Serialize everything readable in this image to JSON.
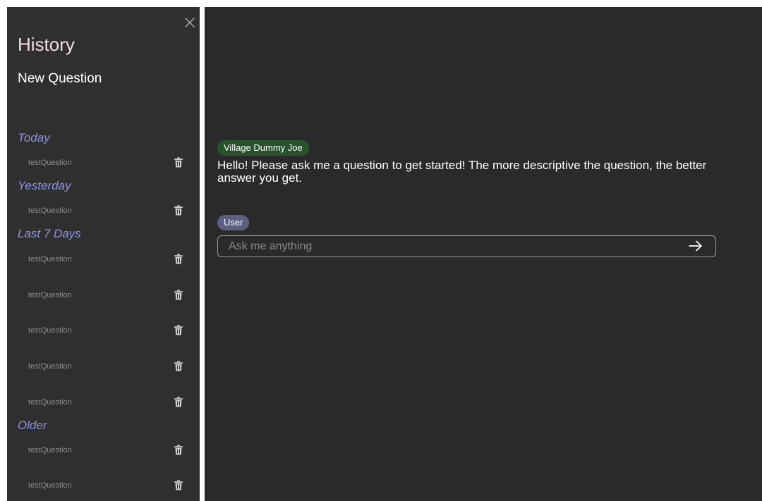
{
  "sidebar": {
    "title": "History",
    "new_question": "New Question",
    "sections": {
      "today": {
        "heading": "Today",
        "items": [
          "testQuestion"
        ]
      },
      "yesterday": {
        "heading": "Yesterday",
        "items": [
          "testQuestion"
        ]
      },
      "last7": {
        "heading": "Last 7 Days",
        "items": [
          "testQuestion",
          "testQuestion",
          "testQuestion",
          "testQuestion",
          "testQuestion"
        ]
      },
      "older": {
        "heading": "Older",
        "items": [
          "testQuestion",
          "testQuestion"
        ]
      }
    },
    "icons": {
      "close": "close-icon",
      "delete": "trash-icon"
    }
  },
  "chat": {
    "bot": {
      "name": "Village Dummy Joe",
      "message": "Hello! Please ask me a question to get started! The more descriptive the question, the better answer you get."
    },
    "user": {
      "name": "User"
    },
    "input": {
      "value": "",
      "placeholder": "Ask me anything"
    },
    "icons": {
      "send": "arrow-right-icon"
    }
  },
  "colors": {
    "sidebar_bg": "#2f2f2f",
    "main_bg": "#2a2a2a",
    "title": "#f2dede",
    "section_heading": "#8f8fe3",
    "history_item": "#8d8d8d",
    "bot_badge": "#28522c",
    "user_badge": "#5e5e85"
  }
}
